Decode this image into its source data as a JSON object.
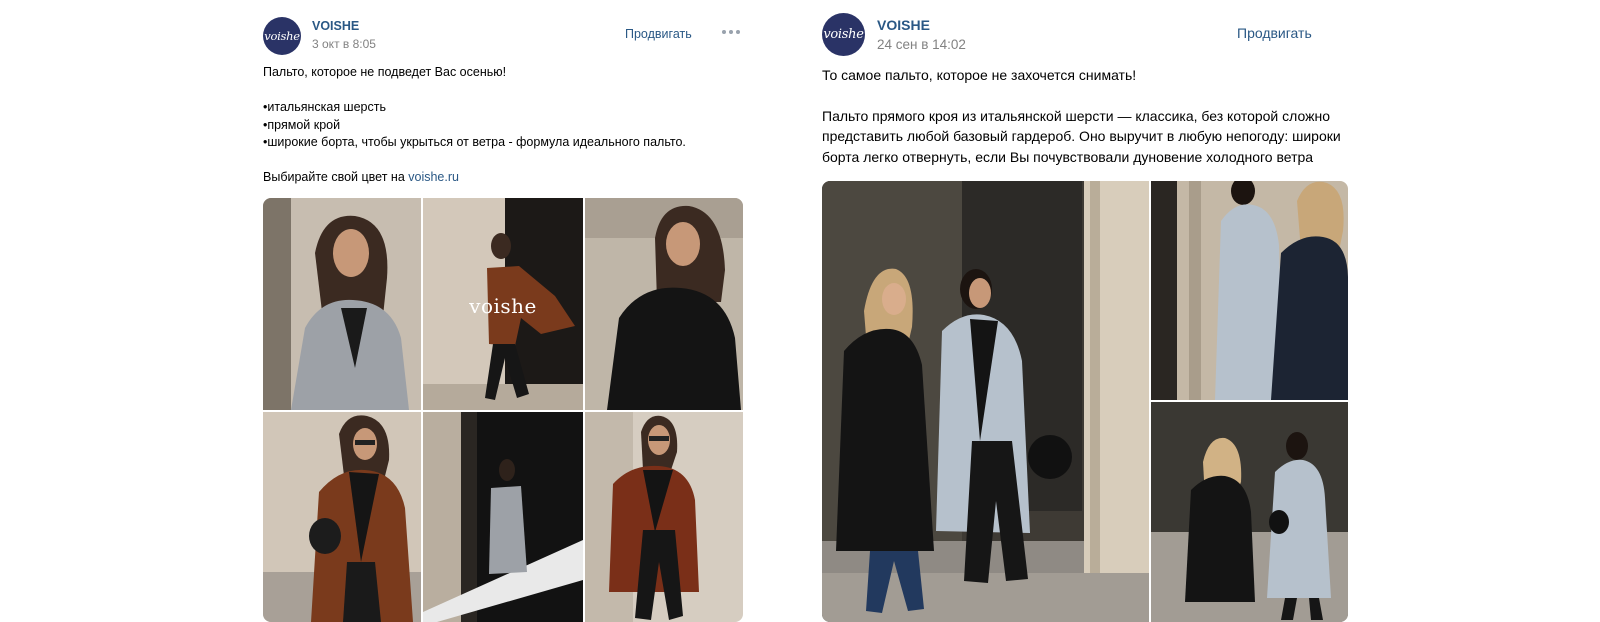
{
  "posts": [
    {
      "author": "VOISHE",
      "avatar_text": "voishe",
      "date": "3 окт в 8:05",
      "promote_label": "Продвигать",
      "more_icon": "more-dots-icon",
      "text": {
        "line1": "Пальто, которое не подведет Вас осенью!",
        "bullet1": "•итальянская шерсть",
        "bullet2": "•прямой крой",
        "bullet3": "•широкие борта, чтобы укрыться от ветра - формула идеального пальто.",
        "cta_prefix": "Выбирайте свой цвет на ",
        "cta_link": "voishe.ru"
      },
      "photo_watermark": "voishe",
      "photo_count": 6
    },
    {
      "author": "VOISHE",
      "avatar_text": "voishe",
      "date": "24 сен в 14:02",
      "promote_label": "Продвигать",
      "text": {
        "line1": "То самое пальто, которое не захочется снимать!",
        "para_line1": "Пальто прямого кроя из итальянской шерсти — классика, без которой сложно",
        "para_line2": "представить любой базовый гардероб. Оно выручит в любую непогоду: широки",
        "para_line3": "борта легко отвернуть, если Вы почувствовали дуновение холодного ветра"
      },
      "photo_count": 3
    }
  ],
  "colors": {
    "link": "#2a5885",
    "meta": "#828282",
    "avatar_bg": "#2a3366",
    "coat_gray": "#9da1a7",
    "coat_brown": "#7a3a1c",
    "coat_black": "#141414",
    "coat_light_blue": "#b6c1cc",
    "coat_navy": "#1c2433"
  }
}
